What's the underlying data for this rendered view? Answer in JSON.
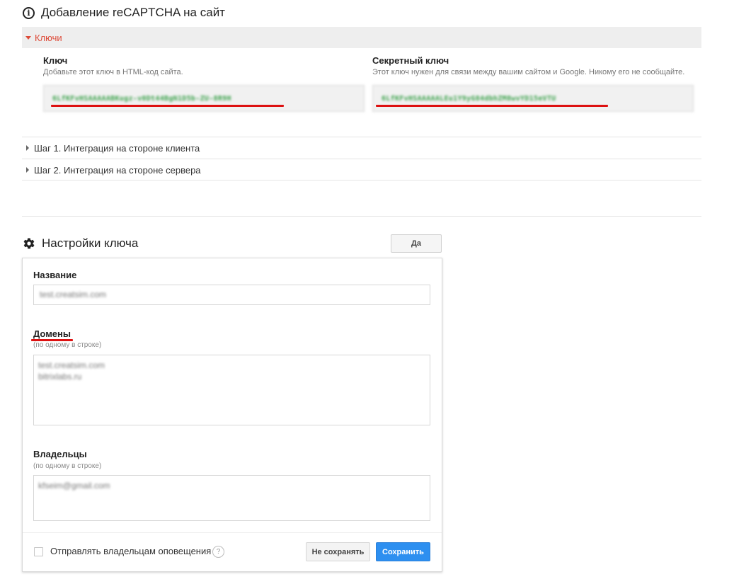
{
  "section_add": {
    "title": "Добавление reCAPTCHA на сайт",
    "keys_toggle": "Ключи",
    "site_key": {
      "title": "Ключ",
      "description": "Добавьте этот ключ в HTML-код сайта.",
      "value": "6LfKFvHSAAAAABKugz-v0Dt44BgN1D5b-ZU-8R9H"
    },
    "secret_key": {
      "title": "Секретный ключ",
      "description": "Этот ключ нужен для связи между вашим сайтом и Google. Никому его не сообщайте.",
      "value": "6LfKFvHSAAAAALEu1Y9yG84dbhZM8wvYD15eVTU"
    },
    "steps": [
      {
        "label": "Шаг 1. Интеграция на стороне клиента"
      },
      {
        "label": "Шаг 2. Интеграция на стороне сервера"
      }
    ]
  },
  "section_settings": {
    "title": "Настройки ключа",
    "toggle_button": "Да",
    "name_field": {
      "label": "Название",
      "value": "test.creatsim.com"
    },
    "domains_field": {
      "label": "Домены",
      "hint": "(по одному в строке)",
      "lines": [
        "test.creatsim.com",
        "bitrixlabs.ru"
      ]
    },
    "owners_field": {
      "label": "Владельцы",
      "hint": "(по одному в строке)",
      "lines": [
        "kfseim@gmail.com"
      ]
    },
    "notify_checkbox": {
      "label": "Отправлять владельцам оповещения",
      "checked": false
    },
    "help_glyph": "?",
    "cancel_button": "Не сохранять",
    "save_button": "Сохранить"
  },
  "colors": {
    "accent_red": "#dd4b39",
    "save_blue": "#2d8ff0",
    "highlight_red": "#dd1111"
  }
}
